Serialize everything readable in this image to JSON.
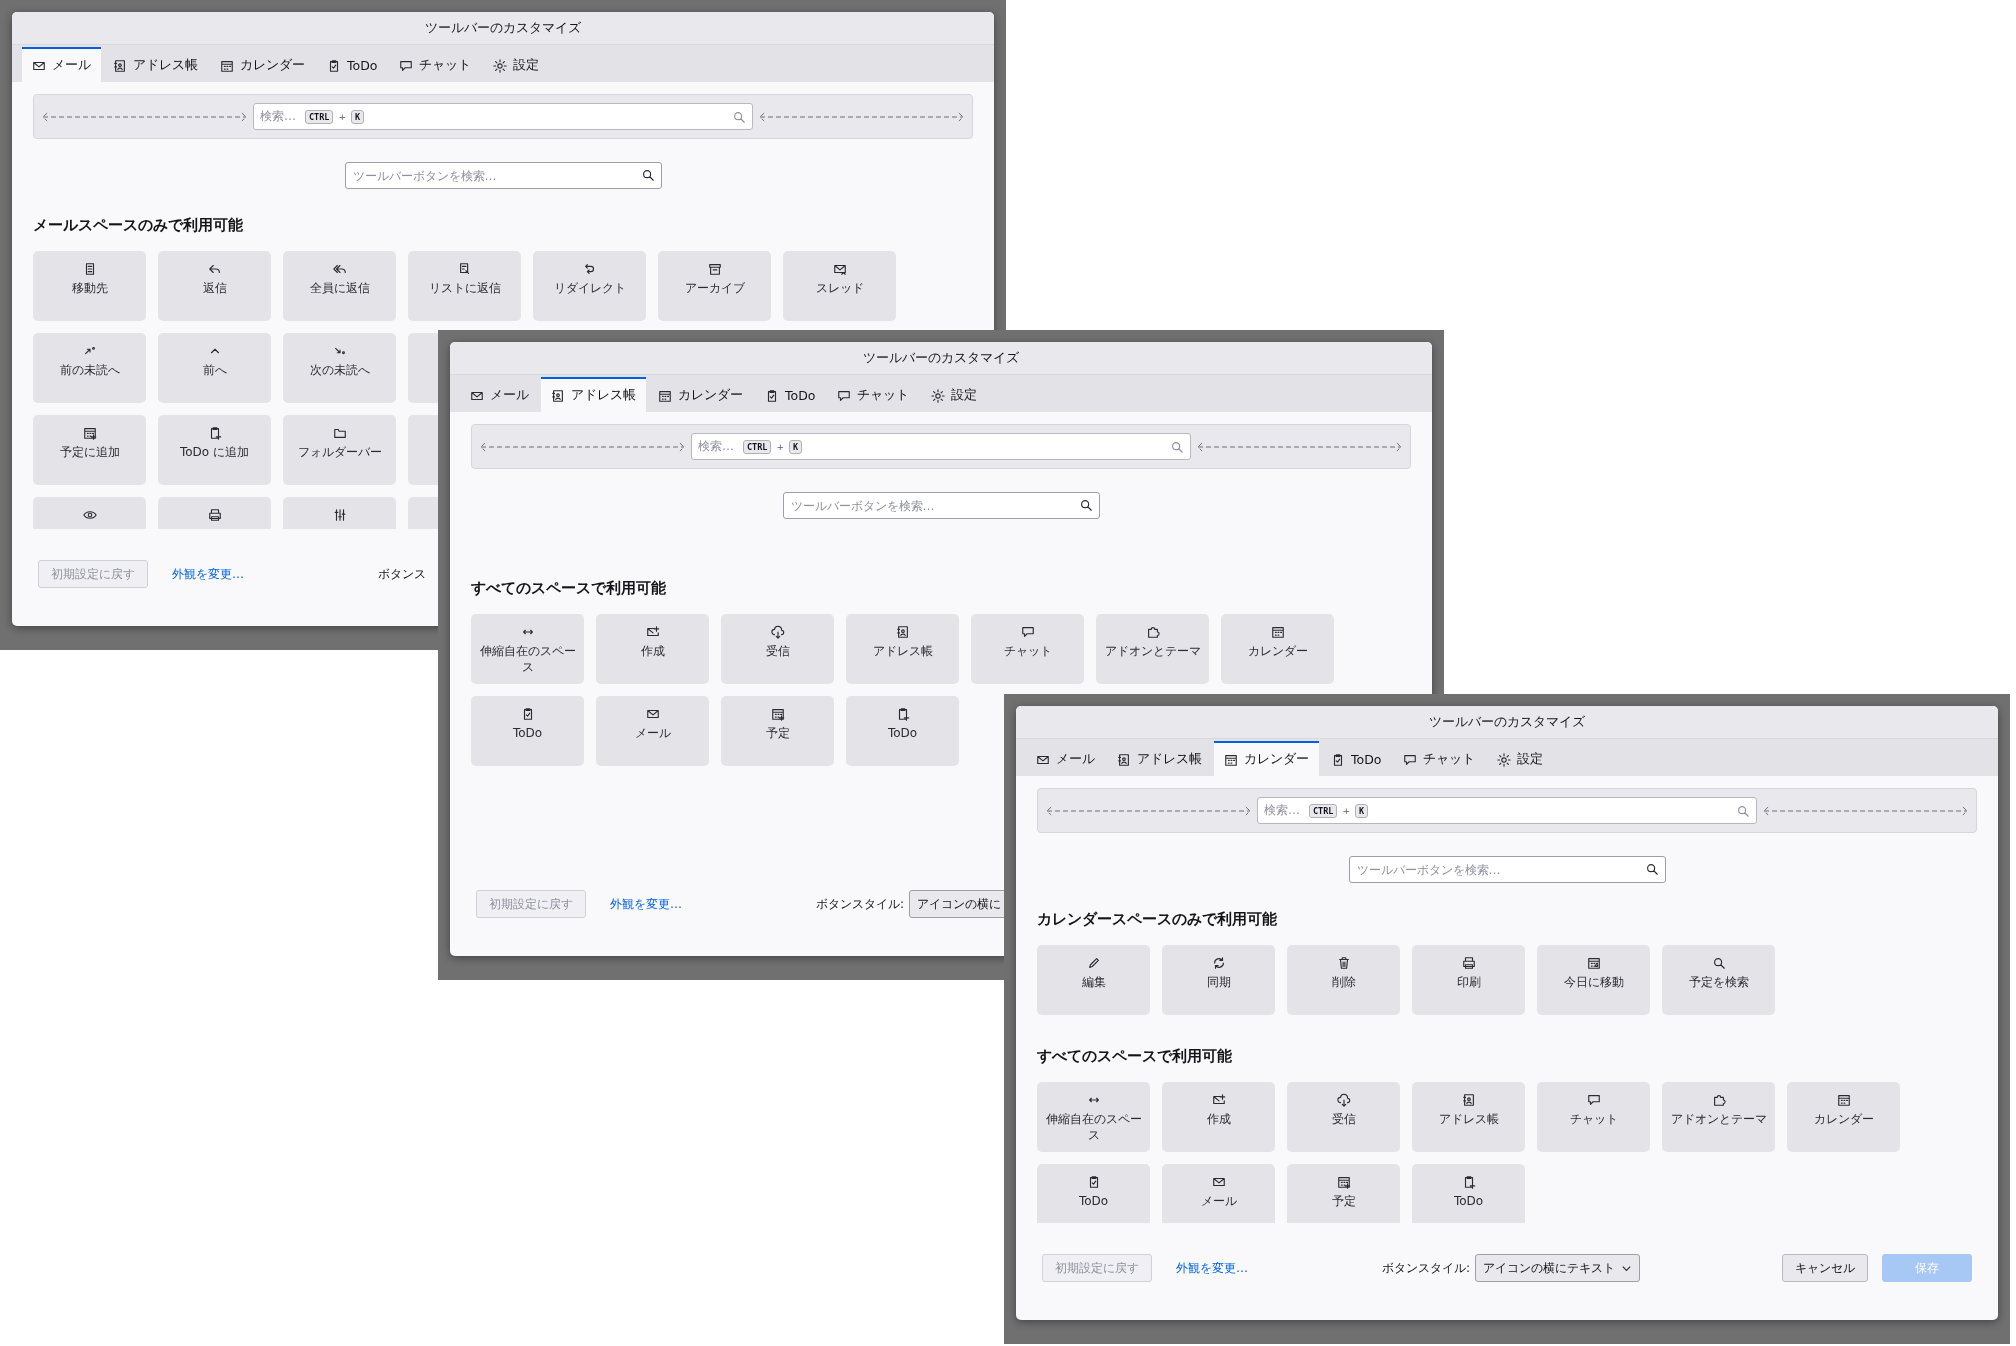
{
  "windows": [
    {
      "title": "ツールバーのカスタマイズ",
      "tabs": [
        {
          "label": "メール",
          "kind": "mail",
          "selected": true
        },
        {
          "label": "アドレス帳",
          "kind": "addressbook",
          "selected": false
        },
        {
          "label": "カレンダー",
          "kind": "calendar",
          "selected": false
        },
        {
          "label": "ToDo",
          "kind": "todo",
          "selected": false
        },
        {
          "label": "チャット",
          "kind": "chat",
          "selected": false
        },
        {
          "label": "設定",
          "kind": "settings",
          "selected": false
        }
      ],
      "toolbar_preview": {
        "placeholder": "検索…",
        "keys": [
          "CTRL",
          "K"
        ],
        "plus": "+"
      },
      "filter": {
        "placeholder": "ツールバーボタンを検索…"
      },
      "sections": [
        {
          "heading": "メールスペースのみで利用可能",
          "rows": [
            [
              {
                "label": "移動先",
                "kind": "doc"
              },
              {
                "label": "返信",
                "kind": "reply"
              },
              {
                "label": "全員に返信",
                "kind": "replyall"
              },
              {
                "label": "リストに返信",
                "kind": "replylist"
              },
              {
                "label": "リダイレクト",
                "kind": "redirect"
              },
              {
                "label": "アーカイブ",
                "kind": "archive"
              },
              {
                "label": "スレッド",
                "kind": "thread"
              }
            ],
            [
              {
                "label": "前の未読へ",
                "kind": "prevunread"
              },
              {
                "label": "前へ",
                "kind": "prev"
              },
              {
                "label": "次の未読へ",
                "kind": "nextunread"
              },
              {
                "kind": "covered"
              }
            ],
            [
              {
                "label": "予定に追加",
                "kind": "eventadd"
              },
              {
                "label": "ToDo に追加",
                "kind": "taskadd"
              },
              {
                "label": "フォルダーバー",
                "kind": "folder"
              },
              {
                "kind": "covered"
              }
            ],
            [
              {
                "kind": "eye"
              },
              {
                "kind": "print"
              },
              {
                "kind": "sliders"
              },
              {
                "kind": "covered"
              }
            ]
          ]
        }
      ],
      "footer": {
        "reset": {
          "label": "初期設定に戻す",
          "disabled": true
        },
        "link": "外観を変更…",
        "style_label": "ボタンス"
      }
    },
    {
      "title": "ツールバーのカスタマイズ",
      "tabs": [
        {
          "label": "メール",
          "kind": "mail",
          "selected": false
        },
        {
          "label": "アドレス帳",
          "kind": "addressbook",
          "selected": true
        },
        {
          "label": "カレンダー",
          "kind": "calendar",
          "selected": false
        },
        {
          "label": "ToDo",
          "kind": "todo",
          "selected": false
        },
        {
          "label": "チャット",
          "kind": "chat",
          "selected": false
        },
        {
          "label": "設定",
          "kind": "settings",
          "selected": false
        }
      ],
      "toolbar_preview": {
        "placeholder": "検索…",
        "keys": [
          "CTRL",
          "K"
        ],
        "plus": "+"
      },
      "filter": {
        "placeholder": "ツールバーボタンを検索…"
      },
      "sections": [
        {
          "heading": "すべてのスペースで利用可能",
          "rows": [
            [
              {
                "label": "伸縮自在のスペース",
                "kind": "spacer"
              },
              {
                "label": "作成",
                "kind": "compose"
              },
              {
                "label": "受信",
                "kind": "cloud"
              },
              {
                "label": "アドレス帳",
                "kind": "addressbook"
              },
              {
                "label": "チャット",
                "kind": "chat"
              },
              {
                "label": "アドオンとテーマ",
                "kind": "puzzle"
              },
              {
                "label": "カレンダー",
                "kind": "calendar"
              }
            ],
            [
              {
                "label": "ToDo",
                "kind": "todo"
              },
              {
                "label": "メール",
                "kind": "mail"
              },
              {
                "label": "予定",
                "kind": "eventadd"
              },
              {
                "label": "ToDo",
                "kind": "taskadd"
              }
            ]
          ]
        }
      ],
      "footer": {
        "reset": {
          "label": "初期設定に戻す",
          "disabled": true
        },
        "link": "外観を変更…",
        "style_label": "ボタンスタイル:",
        "style_value": "アイコンの横に"
      }
    },
    {
      "title": "ツールバーのカスタマイズ",
      "tabs": [
        {
          "label": "メール",
          "kind": "mail",
          "selected": false
        },
        {
          "label": "アドレス帳",
          "kind": "addressbook",
          "selected": false
        },
        {
          "label": "カレンダー",
          "kind": "calendar",
          "selected": true
        },
        {
          "label": "ToDo",
          "kind": "todo",
          "selected": false
        },
        {
          "label": "チャット",
          "kind": "chat",
          "selected": false
        },
        {
          "label": "設定",
          "kind": "settings",
          "selected": false
        }
      ],
      "toolbar_preview": {
        "placeholder": "検索…",
        "keys": [
          "CTRL",
          "K"
        ],
        "plus": "+"
      },
      "filter": {
        "placeholder": "ツールバーボタンを検索…"
      },
      "sections": [
        {
          "heading": "カレンダースペースのみで利用可能",
          "rows": [
            [
              {
                "label": "編集",
                "kind": "pencil"
              },
              {
                "label": "同期",
                "kind": "sync"
              },
              {
                "label": "削除",
                "kind": "trash"
              },
              {
                "label": "印刷",
                "kind": "print"
              },
              {
                "label": "今日に移動",
                "kind": "today"
              },
              {
                "label": "予定を検索",
                "kind": "search"
              }
            ]
          ]
        },
        {
          "heading": "すべてのスペースで利用可能",
          "rows": [
            [
              {
                "label": "伸縮自在のスペース",
                "kind": "spacer"
              },
              {
                "label": "作成",
                "kind": "compose"
              },
              {
                "label": "受信",
                "kind": "cloud"
              },
              {
                "label": "アドレス帳",
                "kind": "addressbook"
              },
              {
                "label": "チャット",
                "kind": "chat"
              },
              {
                "label": "アドオンとテーマ",
                "kind": "puzzle"
              },
              {
                "label": "カレンダー",
                "kind": "calendar"
              }
            ],
            [
              {
                "label": "ToDo",
                "kind": "todo"
              },
              {
                "label": "メール",
                "kind": "mail"
              },
              {
                "label": "予定",
                "kind": "eventadd"
              },
              {
                "label": "ToDo",
                "kind": "taskadd"
              }
            ]
          ]
        }
      ],
      "footer": {
        "reset": {
          "label": "初期設定に戻す",
          "disabled": true
        },
        "link": "外観を変更…",
        "style_label": "ボタンスタイル:",
        "style_value": "アイコンの横にテキスト",
        "cancel": {
          "label": "キャンセル",
          "disabled": false
        },
        "save": {
          "label": "保存",
          "disabled": true
        }
      }
    }
  ]
}
